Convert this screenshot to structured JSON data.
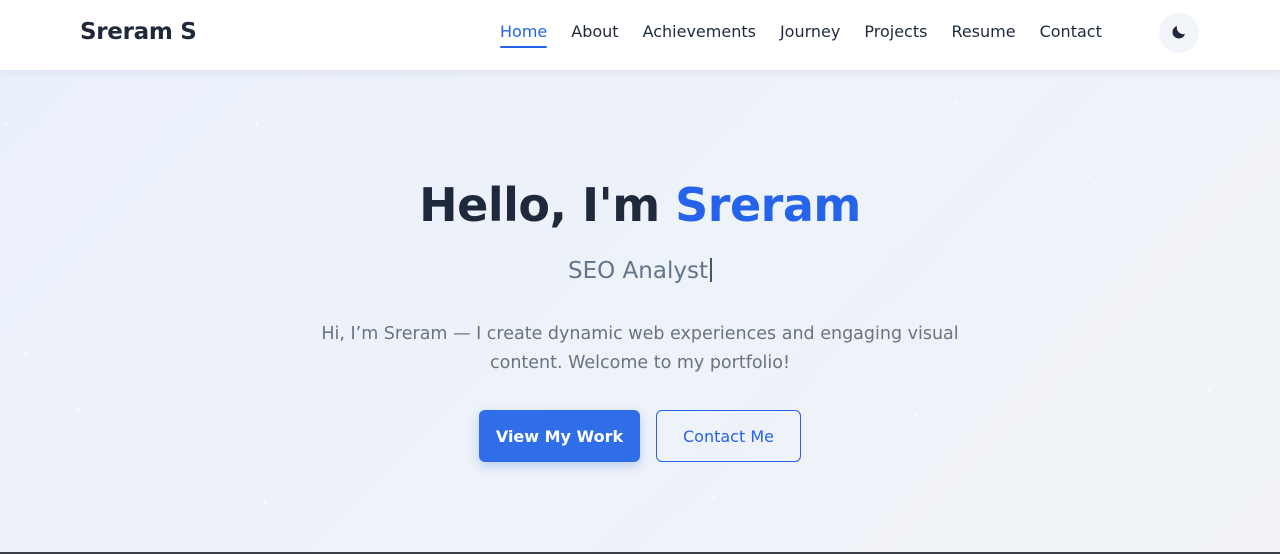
{
  "nav": {
    "brand": "Sreram S",
    "links": [
      {
        "label": "Home",
        "active": true
      },
      {
        "label": "About"
      },
      {
        "label": "Achievements"
      },
      {
        "label": "Journey"
      },
      {
        "label": "Projects"
      },
      {
        "label": "Resume"
      },
      {
        "label": "Contact"
      }
    ],
    "theme_toggle_icon": "moon-icon"
  },
  "hero": {
    "greeting": "Hello, I'm ",
    "name": "Sreram",
    "role": "SEO Analyst",
    "description": "Hi, I’m Sreram — I create dynamic web experiences and engaging visual content. Welcome to my portfolio!",
    "primary_button": "View My Work",
    "secondary_button": "Contact Me"
  },
  "colors": {
    "accent": "#2563eb",
    "heading": "#1e293b",
    "muted": "#6b7280",
    "background": "#eef2f9"
  }
}
